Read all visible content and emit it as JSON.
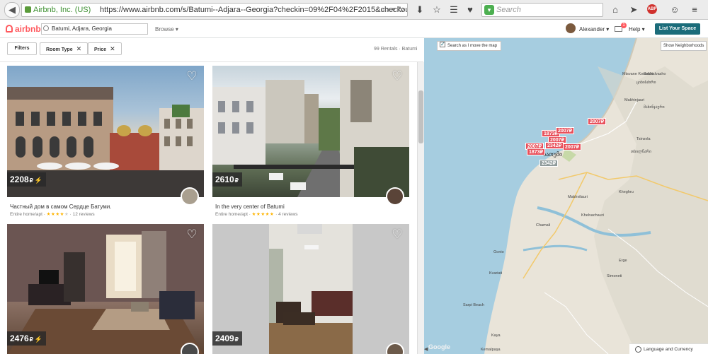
{
  "browser": {
    "site_identity": "Airbnb, Inc. (US)",
    "url": "https://www.airbnb.com/s/Batumi--Adjara--Georgia?checkin=09%2F04%2F2015&checkout=09%2F08%2F20",
    "search_placeholder": "Search",
    "adblock_label": "ABP"
  },
  "header": {
    "logo_text": "airbnb",
    "location_value": "Batumi, Adjara, Georgia",
    "browse_label": "Browse",
    "user_name": "Alexander",
    "mail_count": "1",
    "help_label": "Help",
    "list_space_label": "List Your Space",
    "colors": {
      "brand": "#ff5a5f",
      "list_space_bg": "#1b6c7a"
    }
  },
  "filters": {
    "filters_label": "Filters",
    "room_type_label": "Room Type",
    "price_label": "Price",
    "close_glyph": "✕",
    "rentals_count": "99 Rentals · Batumi"
  },
  "listings": [
    {
      "price": "2208",
      "currency": "₽",
      "instant": true,
      "title": "Частный дом в самом Сердце Батуми.",
      "type": "Entire home/apt",
      "stars_full": "★★★★",
      "stars_empty": "★",
      "reviews": "12 reviews"
    },
    {
      "price": "2610",
      "currency": "₽",
      "instant": false,
      "title": "In the very center of Batumi",
      "type": "Entire home/apt",
      "stars_full": "★★★★★",
      "stars_empty": "",
      "reviews": "4 reviews"
    },
    {
      "price": "2476",
      "currency": "₽",
      "instant": true,
      "title": "",
      "type": "",
      "stars_full": "",
      "stars_empty": "",
      "reviews": ""
    },
    {
      "price": "2409",
      "currency": "₽",
      "instant": false,
      "title": "",
      "type": "",
      "stars_full": "",
      "stars_empty": "",
      "reviews": ""
    }
  ],
  "map": {
    "search_as_move_label": "Search as I move the map",
    "show_neighborhoods_label": "Show Neighborhoods",
    "language_currency_label": "Language and Currency",
    "google_label": "Google",
    "pins": [
      {
        "label": "2007₽",
        "highlight": true
      },
      {
        "label": "1873₽",
        "highlight": true
      },
      {
        "label": "2007₽",
        "highlight": true
      },
      {
        "label": "2342₽",
        "highlight": true
      },
      {
        "label": "2007₽",
        "highlight": true
      },
      {
        "label": "1873₽",
        "highlight": true
      },
      {
        "label": "2007₽",
        "highlight": true
      },
      {
        "label": "2342₽",
        "highlight": false
      }
    ],
    "towns": [
      "Mtsvane Kontskhi",
      "Sakhalvasho",
      "Makhinjauri",
      "Tsinsvla",
      "Batumi",
      "Khelvachauri",
      "Kheghru",
      "Makhvilauri",
      "Chamali",
      "Gonio",
      "Kvariati",
      "Erge",
      "Simoneti",
      "Sarpi Beach",
      "Kaya",
      "Kemalpaşa",
      "ბათუმი",
      "ციხისძირი",
      "თხილნარი",
      "მახინჯაური"
    ]
  }
}
